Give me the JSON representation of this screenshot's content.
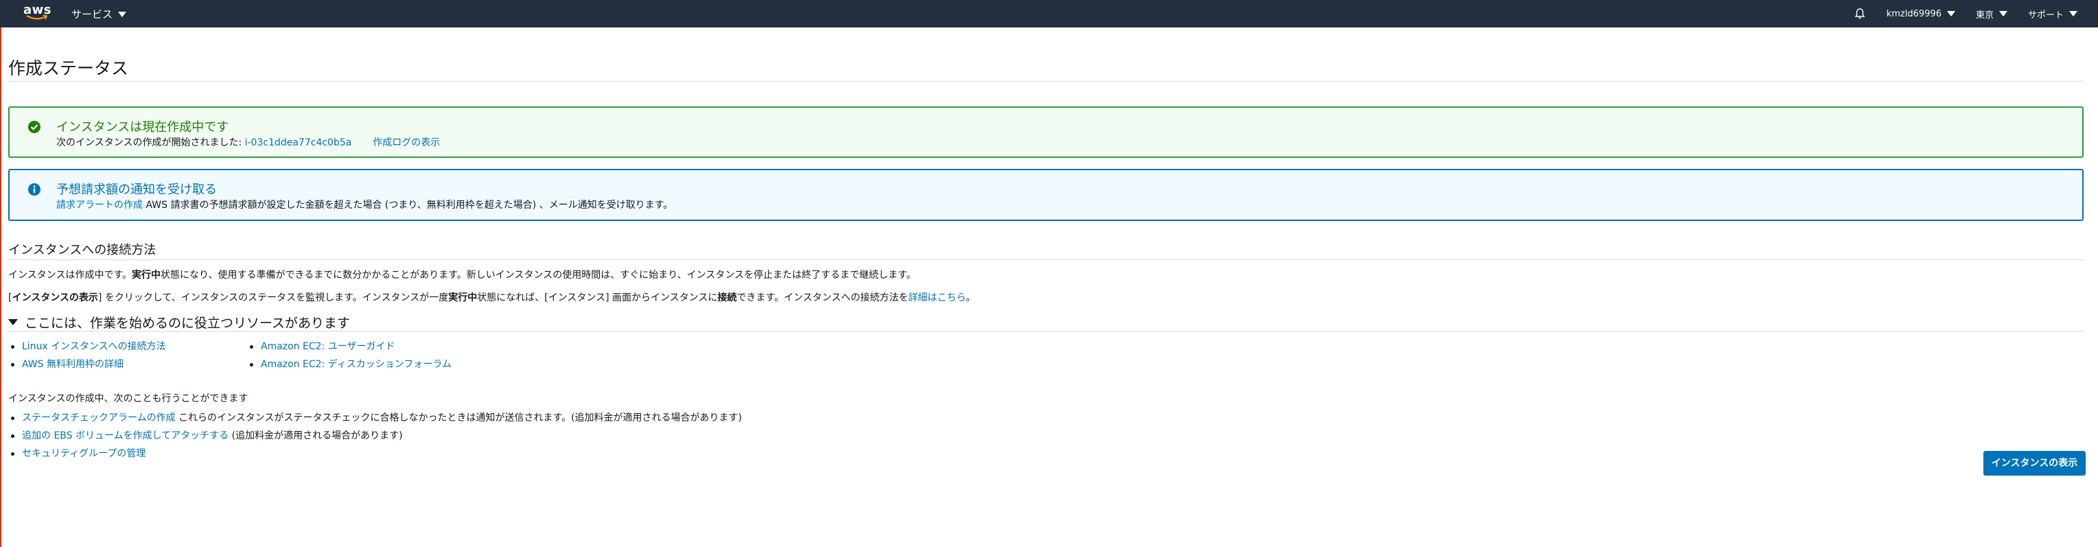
{
  "colors": {
    "nav_bg": "#232f3e",
    "link": "#0073bb",
    "success_border": "#2e9e3d",
    "success_bg": "#f2fcf3",
    "success_text": "#1d8102",
    "info_border": "#0073bb",
    "info_bg": "#f1faff",
    "primary_button": "#0073bb"
  },
  "topnav": {
    "logo_text": "aws",
    "services_label": "サービス",
    "bell_icon": "bell-icon",
    "account_label": "kmzld69996",
    "region_label": "東京",
    "support_label": "サポート"
  },
  "page": {
    "title": "作成ステータス"
  },
  "success_alert": {
    "icon": "check-circle-icon",
    "title": "インスタンスは現在作成中です",
    "body_prefix": "次のインスタンスの作成が開始されました: ",
    "instance_id": "i-03c1ddea77c4c0b5a",
    "log_link": "作成ログの表示"
  },
  "info_alert": {
    "icon": "info-circle-icon",
    "title": "予想請求額の通知を受け取る",
    "link": "請求アラートの作成",
    "body": " AWS 請求書の予想請求額が設定した金額を超えた場合 (つまり、無料利用枠を超えた場合) 、メール通知を受け取ります。"
  },
  "connect_section": {
    "title": "インスタンスへの接続方法",
    "p1_part1": "インスタンスは作成中です。",
    "p1_bold": "実行中",
    "p1_part2": "状態になり、使用する準備ができるまでに数分かかることがあります。新しいインスタンスの使用時間は、すぐに始まり、インスタンスを停止または終了するまで継続します。",
    "p2_part1": "[",
    "p2_bold1": "インスタンスの表示",
    "p2_part2": "] をクリックして、インスタンスのステータスを監視します。インスタンスが一度",
    "p2_bold2": "実行中",
    "p2_part3": "状態になれば、[インスタンス] 画面からインスタンスに",
    "p2_bold3": "接続",
    "p2_part4": "できます。インスタンスへの接続方法を",
    "p2_link": "詳細はこちら",
    "p2_end": "。"
  },
  "resources": {
    "header": "ここには、作業を始めるのに役立つリソースがあります",
    "col1": [
      "Linux インスタンスへの接続方法",
      "AWS 無料利用枠の詳細"
    ],
    "col2": [
      "Amazon EC2: ユーザーガイド",
      "Amazon EC2: ディスカッションフォーラム"
    ]
  },
  "also": {
    "title": "インスタンスの作成中、次のことも行うことができます",
    "items": [
      {
        "link": "ステータスチェックアラームの作成",
        "text": " これらのインスタンスがステータスチェックに合格しなかったときは通知が送信されます。(追加料金が適用される場合があります)"
      },
      {
        "link": "追加の EBS ボリュームを作成してアタッチする",
        "text": " (追加料金が適用される場合があります)"
      },
      {
        "link": "セキュリティグループの管理",
        "text": ""
      }
    ]
  },
  "actions": {
    "view_instances": "インスタンスの表示"
  }
}
